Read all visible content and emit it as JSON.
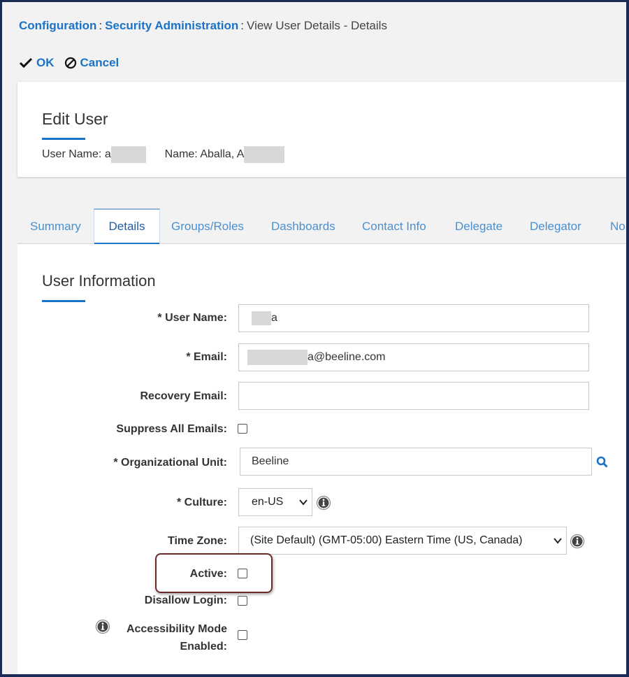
{
  "breadcrumb": {
    "items": [
      "Configuration",
      "Security Administration"
    ],
    "separator": ":",
    "current": "View User Details - Details"
  },
  "toolbar": {
    "ok_label": "OK",
    "cancel_label": "Cancel"
  },
  "header": {
    "title": "Edit User",
    "user_name_label": "User Name:",
    "user_name_value_visible": "a",
    "name_label": "Name:",
    "name_value_visible": "Aballa, A"
  },
  "tabs": [
    {
      "label": "Summary",
      "active": false
    },
    {
      "label": "Details",
      "active": true
    },
    {
      "label": "Groups/Roles",
      "active": false
    },
    {
      "label": "Dashboards",
      "active": false
    },
    {
      "label": "Contact Info",
      "active": false
    },
    {
      "label": "Delegate",
      "active": false
    },
    {
      "label": "Delegator",
      "active": false
    },
    {
      "label": "No",
      "active": false
    }
  ],
  "section": {
    "title": "User Information"
  },
  "form": {
    "user_name": {
      "label": "* User Name:",
      "value_visible": "a"
    },
    "email": {
      "label": "* Email:",
      "value_visible": "a@beeline.com"
    },
    "recovery_email": {
      "label": "Recovery Email:",
      "value": ""
    },
    "suppress_all_emails": {
      "label": "Suppress All Emails:",
      "checked": false
    },
    "org_unit": {
      "label": "* Organizational Unit:",
      "value": "Beeline"
    },
    "culture": {
      "label": "* Culture:",
      "value": "en-US"
    },
    "time_zone": {
      "label": "Time Zone:",
      "value": "(Site Default) (GMT-05:00) Eastern Time (US, Canada)"
    },
    "active": {
      "label": "Active:",
      "checked": false
    },
    "disallow_login": {
      "label": "Disallow Login:",
      "checked": false
    },
    "accessibility_mode": {
      "label_line1": "Accessibility Mode",
      "label_line2": "Enabled:",
      "checked": false
    }
  },
  "colors": {
    "link": "#1a73c9",
    "highlight_border": "#6b2a2a",
    "outer_frame": "#1c2a56"
  },
  "icons": [
    "checkmark-icon",
    "cancel-circle-icon",
    "search-icon",
    "info-icon",
    "chevron-down-icon"
  ]
}
